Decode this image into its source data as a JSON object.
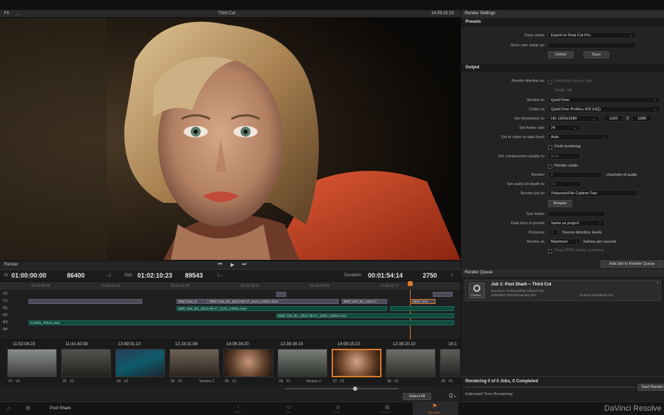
{
  "viewer": {
    "fit_label": "Fit",
    "timeline_name": "Third Cut",
    "timecode": "14:09:15:23"
  },
  "render_settings": {
    "title": "Render Settings",
    "presets_header": "Presets",
    "easy_setup_label": "Easy setup:",
    "easy_setup_value": "Export to Final Cut Pro",
    "save_setup_label": "Save user setup as:",
    "delete_label": "Delete",
    "save_label": "Save",
    "output_header": "Output",
    "render_timeline_label": "Render timeline as:",
    "individual_clips": "Individual source clips",
    "single_clip": "Single clip",
    "render_to_label": "Render to:",
    "render_to_value": "QuickTime",
    "codec_label": "Codec is:",
    "codec_value": "QuickTime ProRes 422 (HQ)",
    "resolution_label": "Set Resolution to:",
    "resolution_value": "HD 1920x1080",
    "res_w": "1920",
    "res_x": "X",
    "res_h": "1080",
    "frame_rate_label": "Set frame rate:",
    "frame_rate_value": "24",
    "video_level_label": "Set to video or data level:",
    "video_level_value": "Auto",
    "field_rendering": "Field rendering",
    "compression_label": "Set compression quality to:",
    "compression_value": "Best",
    "render_audio": "Render audio",
    "render_label": "Render:",
    "render_value": "2",
    "channels_label": "channels of audio",
    "bit_depth_label": "Set audio bit depth to:",
    "bit_depth_value": "16",
    "render_job_label": "Render job to:",
    "render_job_value": "/Volumes/File Cabinet Two",
    "browse_label": "Browse",
    "sub_folder_label": "Sub folder:",
    "burn_in_label": "Data burn in preset:",
    "burn_in_value": "Same as project",
    "preserve_label": "Preserve:",
    "preserve_value": "0",
    "source_levels": "Source directory levels",
    "render_at_label": "Render at:",
    "render_at_value": "Maximum",
    "frames_per_second": "frames per second",
    "show_rpm": "Show RPM during rendering",
    "add_job_label": "Add Job to Render Queue"
  },
  "transport": {
    "mode_label": "Render",
    "in_label": "In:",
    "in_tc": "01:00:00:00",
    "in_frames": "86400",
    "out_label": "Out:",
    "out_tc": "01:02:10:23",
    "out_frames": "89543",
    "duration_label": "Duration:",
    "duration_tc": "00:01:54:14",
    "duration_frames": "2750"
  },
  "ruler": [
    "01:00:00:00",
    "01:00:06:13",
    "01:00:13:02",
    "01:00:19:15",
    "01:00:26:04",
    "01:00:32:17"
  ],
  "tracks": {
    "labels": [
      "V2",
      "V1",
      "A1",
      "A2",
      "A3",
      "A4"
    ],
    "clips": [
      "BMC test_8",
      "BMC test_B1_2012-08-17_1141_C0001.mov",
      "BMC test_B1_2012-0",
      "BMC test",
      "BMC test_B1_2012-08-17_1141_C0001.mov",
      "BMC test_B1_2012-08-17_1000_C0001.mov",
      "CU001_FINAL.wav"
    ]
  },
  "thumbnails": [
    {
      "tc": "11:02:04:23",
      "label": "01",
      "track": "V1"
    },
    {
      "tc": "11:41:40:08",
      "label": "02",
      "track": "V1"
    },
    {
      "tc": "13:49:31:10",
      "label": "03",
      "track": "V2"
    },
    {
      "tc": "12:16:31:06",
      "label": "04",
      "track": "V1"
    },
    {
      "tc": "14:06:34:20",
      "label": "05",
      "track": "V1",
      "version": "Version 2"
    },
    {
      "tc": "12:38:16:15",
      "label": "06",
      "track": "V1"
    },
    {
      "tc": "14:09:15:23",
      "label": "07",
      "track": "V1",
      "version": "Version 2"
    },
    {
      "tc": "12:38:20:10",
      "label": "08",
      "track": "V1"
    },
    {
      "tc": "16:1",
      "label": "09",
      "track": "V1"
    }
  ],
  "select_all": "Select All",
  "render_queue": {
    "title": "Render Queue",
    "job_title": "Job 1: Pool Shark -- Third Cut",
    "job_saving": "Saving to: /Volumes/File Cabinet Two",
    "job_remaining": "Estimated Time Remaining: N/A",
    "job_amount": "Amount Completed: 0%",
    "codec_badge": "ProRes",
    "status": "Rendering 0 of 0 Jobs, 0 Completed",
    "time_remaining": "Estimated Time Remaining:",
    "start_label": "Start Render"
  },
  "footer": {
    "project_name": "Pool Shark",
    "brand": "DaVinci Resolve",
    "pages": [
      "MEDIA",
      "EDIT",
      "COLOR",
      "GALLERY",
      "DELIVER"
    ]
  },
  "colors": {
    "accent": "#e07b2a",
    "audio_clip": "#0f4a3e",
    "video_clip": "#4a4b57"
  }
}
